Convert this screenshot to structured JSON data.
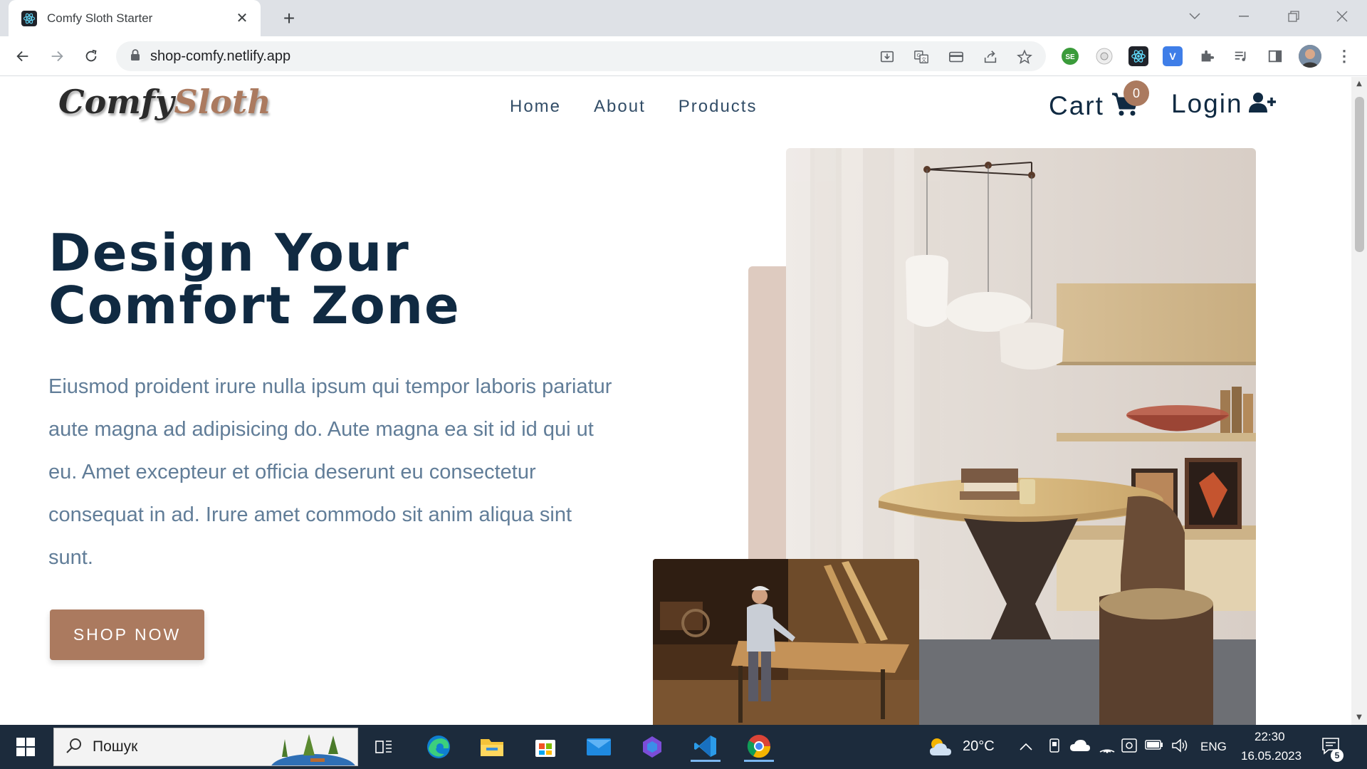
{
  "browser": {
    "tab_title": "Comfy Sloth Starter",
    "url": "shop-comfy.netlify.app"
  },
  "site": {
    "logo_part1": "Comfy",
    "logo_part2": "Sloth",
    "nav": [
      "Home",
      "About",
      "Products"
    ],
    "cart_label": "Cart",
    "cart_count": "0",
    "login_label": "Login"
  },
  "hero": {
    "title_line1": "Design Your",
    "title_line2": "Comfort Zone",
    "text": "Eiusmod proident irure nulla ipsum qui tempor laboris pariatur aute magna ad adipisicing do. Aute magna ea sit id id qui ut eu. Amet excepteur et officia deserunt eu consectetur consequat in ad. Irure amet commodo sit anim aliqua sint sunt.",
    "button": "SHOP NOW"
  },
  "colors": {
    "brand": "#ab7a5f",
    "heading": "#102a42",
    "body_text": "#617d98",
    "accent_block": "#decbc0"
  },
  "taskbar": {
    "search_placeholder": "Пошук",
    "weather": "20°C",
    "language": "ENG",
    "time": "22:30",
    "date": "16.05.2023",
    "notification_count": "5"
  }
}
